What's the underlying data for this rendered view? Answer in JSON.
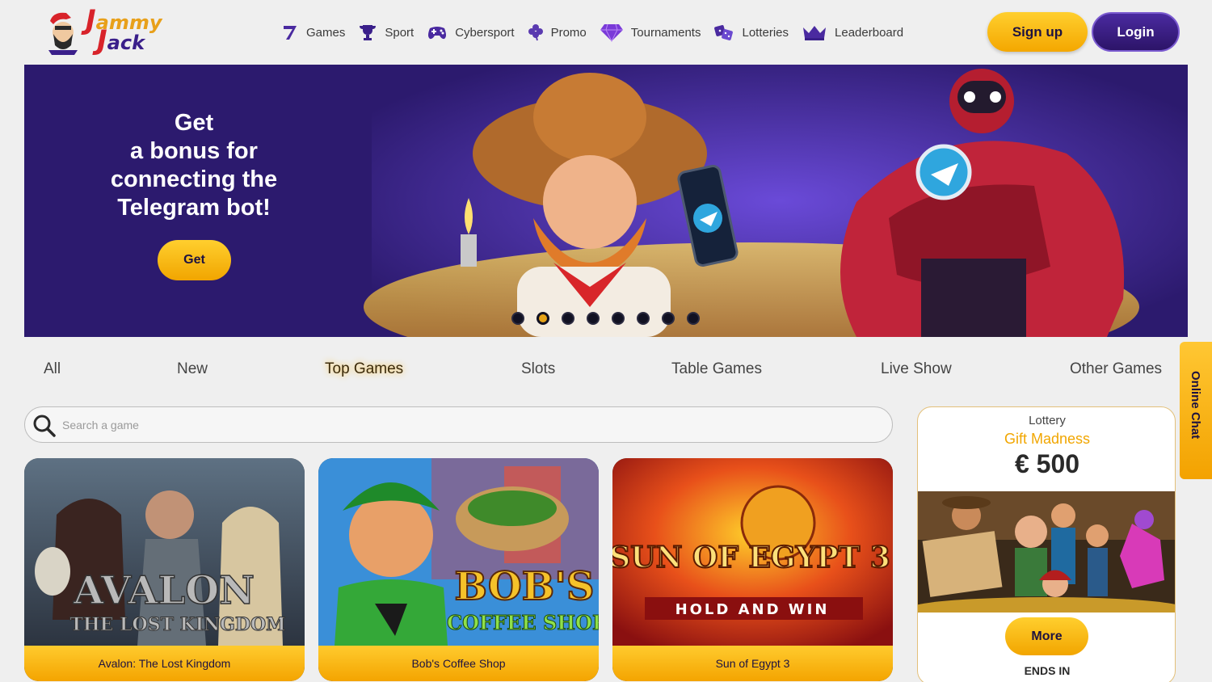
{
  "brand": {
    "logo_line1": "ammy",
    "logo_line2": "ack",
    "logo_initial1": "J",
    "logo_initial2": "J"
  },
  "nav": [
    {
      "label": "Games",
      "icon": "seven-icon"
    },
    {
      "label": "Sport",
      "icon": "trophy-icon"
    },
    {
      "label": "Cybersport",
      "icon": "gamepad-icon"
    },
    {
      "label": "Promo",
      "icon": "clover-icon"
    },
    {
      "label": "Tournaments",
      "icon": "diamond-icon"
    },
    {
      "label": "Lotteries",
      "icon": "dice-icon"
    },
    {
      "label": "Leaderboard",
      "icon": "crown-icon"
    }
  ],
  "auth": {
    "signup_label": "Sign up",
    "login_label": "Login"
  },
  "banner": {
    "title": "Get\na bonus for\nconnecting the\nTelegram bot!",
    "button_label": "Get",
    "slides_count": 8,
    "active_slide": 1
  },
  "tabs": [
    "All",
    "New",
    "Top Games",
    "Slots",
    "Table Games",
    "Live Show",
    "Other Games"
  ],
  "active_tab": "Top Games",
  "search": {
    "placeholder": "Search a game"
  },
  "games": [
    {
      "title": "Avalon: The Lost Kingdom",
      "art_text": "AVALON",
      "art_sub": "THE LOST KINGDOM"
    },
    {
      "title": "Bob's Coffee Shop",
      "art_text": "BOB'S",
      "art_sub": "COFFEE SHOP"
    },
    {
      "title": "Sun of Egypt 3",
      "art_text": "SUN OF EGYPT 3",
      "art_sub": "HOLD AND WIN"
    }
  ],
  "lottery": {
    "category": "Lottery",
    "name": "Gift Madness",
    "amount": "€ 500",
    "button_label": "More",
    "ends_label": "ENDS IN"
  },
  "online_chat_label": "Online Chat",
  "colors": {
    "accent": "#f4a700",
    "brand_purple": "#2c1468",
    "banner_bg": "#2c1a6e"
  }
}
